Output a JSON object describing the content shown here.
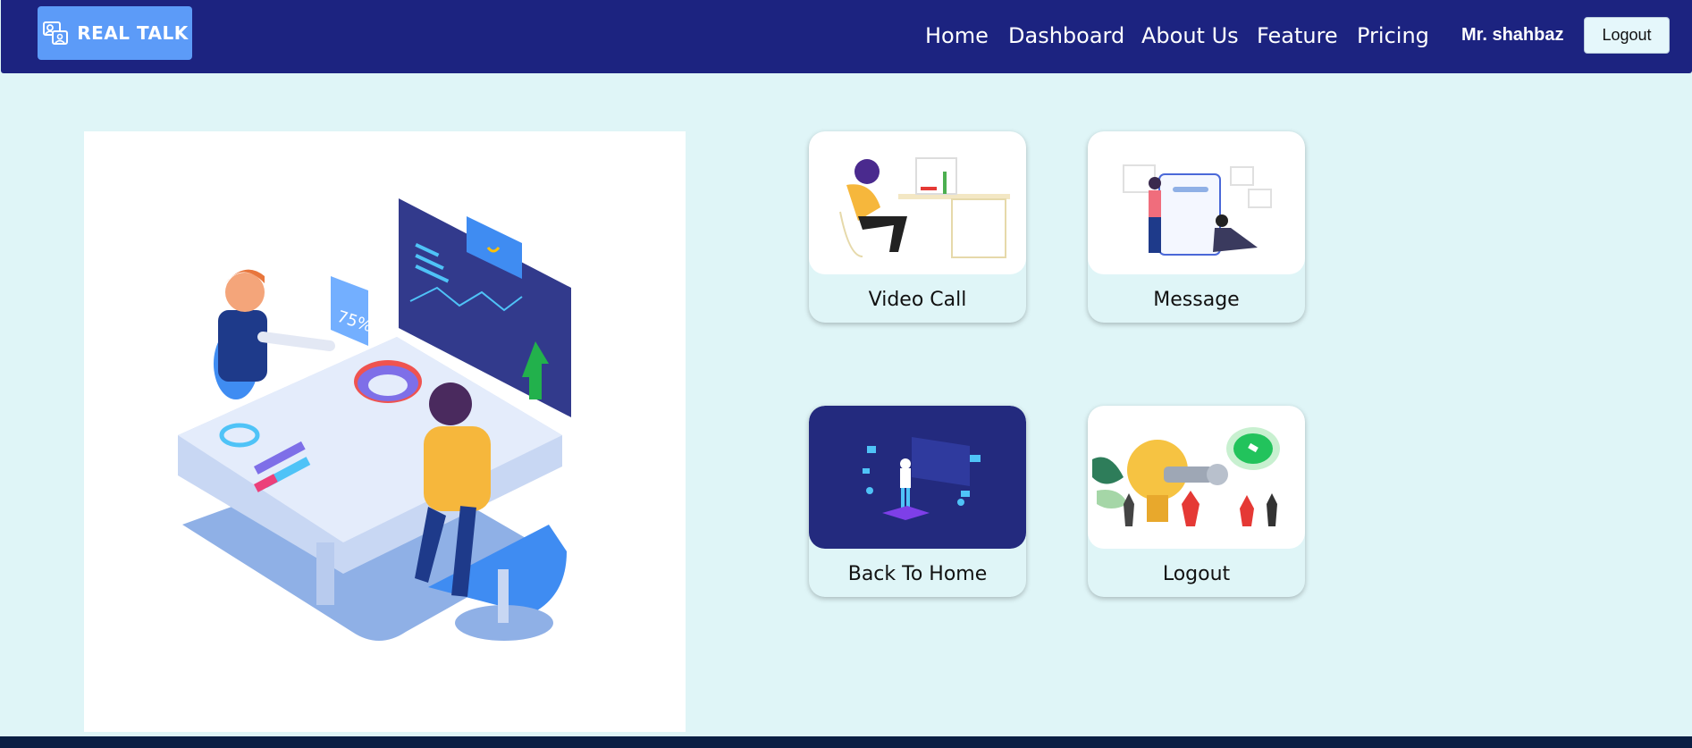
{
  "header": {
    "logo_text": "REAL TALK",
    "nav": [
      "Home",
      "Dashboard",
      "About Us",
      "Feature",
      "Pricing"
    ],
    "user": "Mr. shahbaz",
    "logout_label": "Logout"
  },
  "hero": {
    "badge_text": "75%"
  },
  "cards": [
    {
      "label": "Video Call"
    },
    {
      "label": "Message"
    },
    {
      "label": "Back To Home"
    },
    {
      "label": "Logout"
    }
  ],
  "colors": {
    "nav_bg": "#1c2380",
    "logo_bg": "#5c9bf8",
    "page_bg": "#dff5f7",
    "footer_bg": "#0a1f44"
  }
}
